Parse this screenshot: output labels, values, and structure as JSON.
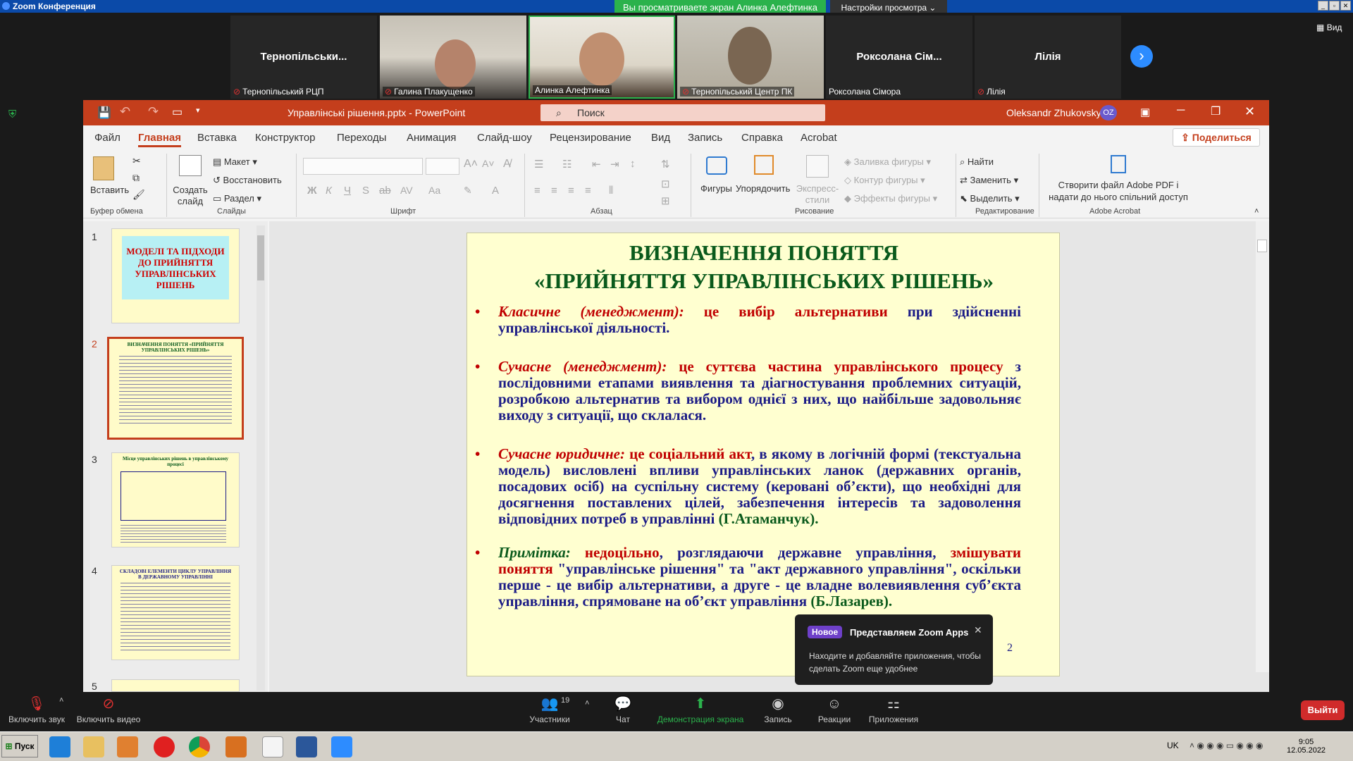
{
  "zoom": {
    "window_title": "Zoom Конференция",
    "share_banner": "Вы просматриваете экран Алинка Алефтинка",
    "view_settings": "Настройки просмотра",
    "view_label": "Вид",
    "participants": [
      {
        "name": "Тернопільськи...",
        "label": "Тернопільський РЦП",
        "muted": true,
        "video": false
      },
      {
        "name": "",
        "label": "Галина Плакущенко",
        "muted": true,
        "video": true
      },
      {
        "name": "",
        "label": "Алинка Алефтинка",
        "muted": false,
        "video": true,
        "active": true
      },
      {
        "name": "",
        "label": "Тернопільський Центр ПК",
        "muted": true,
        "video": true
      },
      {
        "name": "Роксолана Сім...",
        "label": "Роксолана Сімора",
        "muted": false,
        "video": false
      },
      {
        "name": "Лілія",
        "label": "Лілія",
        "muted": true,
        "video": false
      }
    ],
    "toolbar": {
      "audio": "Включить звук",
      "video": "Включить видео",
      "participants": "Участники",
      "participants_count": "19",
      "chat": "Чат",
      "share": "Демонстрация экрана",
      "record": "Запись",
      "reactions": "Реакции",
      "apps": "Приложения",
      "leave": "Выйти"
    },
    "toast": {
      "badge": "Новое",
      "title": "Представляем Zoom Apps",
      "body": "Находите и добавляйте приложения, чтобы сделать Zoom еще удобнее"
    }
  },
  "ppt": {
    "title": "Управлінські рішення.pptx  -  PowerPoint",
    "search_placeholder": "Поиск",
    "user": "Oleksandr Zhukovsky",
    "user_initials": "OZ",
    "share_button": "Поделиться",
    "tabs": [
      "Файл",
      "Главная",
      "Вставка",
      "Конструктор",
      "Переходы",
      "Анимация",
      "Слайд-шоу",
      "Рецензирование",
      "Вид",
      "Запись",
      "Справка",
      "Acrobat"
    ],
    "active_tab": "Главная",
    "ribbon": {
      "clipboard_paste": "Вставить",
      "clipboard_group": "Буфер обмена",
      "new_slide": "Создать слайд",
      "layout": "Макет",
      "reset": "Восстановить",
      "section": "Раздел",
      "slides_group": "Слайды",
      "font_group": "Шрифт",
      "paragraph_group": "Абзац",
      "shapes": "Фигуры",
      "arrange": "Упорядочить",
      "quick_styles": "Экспресс-стили",
      "shape_fill": "Заливка фигуры",
      "shape_outline": "Контур фигуры",
      "shape_effects": "Эффекты фигуры",
      "drawing_group": "Рисование",
      "find": "Найти",
      "replace": "Заменить",
      "select": "Выделить",
      "editing_group": "Редактирование",
      "acrobat_btn": "Створити файл Adobe PDF і надати до нього спільний доступ",
      "acrobat_group": "Adobe Acrobat"
    },
    "thumbnails": [
      {
        "num": "1",
        "text": "МОДЕЛІ ТА ПІДХОДИ ДО ПРИЙНЯТТЯ УПРАВЛІНСЬКИХ РІШЕНЬ"
      },
      {
        "num": "2",
        "text": "ВИЗНАЧЕННЯ ПОНЯТТЯ «ПРИЙНЯТТЯ УПРАВЛІНСЬКИХ РІШЕНЬ»"
      },
      {
        "num": "3",
        "text": "Місце управлінських рішень в управлінському процесі"
      },
      {
        "num": "4",
        "text": "СКЛАДОВІ ЕЛЕМЕНТИ ЦИКЛУ УПРАВЛІННЯ В ДЕРЖАВНОМУ УПРАВЛІННІ"
      },
      {
        "num": "5",
        "text": ""
      }
    ],
    "slide": {
      "title_line1": "ВИЗНАЧЕННЯ ПОНЯТТЯ",
      "title_line2": "«ПРИЙНЯТТЯ УПРАВЛІНСЬКИХ РІШЕНЬ»",
      "b1_term": "Класичне (менеджмент):",
      "b1_red": " це вибір альтернативи",
      "b1_rest": " при здійсненні управлінської діяльності.",
      "b2_term": "Сучасне (менеджмент):",
      "b2_red": " це суттєва частина управлінського процесу",
      "b2_rest": " з послідовними етапами виявлення та діагностування проблемних ситуацій, розробкою альтернатив та вибором однієї з них, що найбільше задовольняє виходу з ситуації, що склалася.",
      "b3_term": "Сучасне юридичне:",
      "b3_red": " це соціальний акт",
      "b3_rest": ", в якому в логічній формі (текстуальна модель) висловлені впливи управлінських ланок (державних органів, посадових осіб) на суспільну систему (керовані об’єкти), що необхідні для досягнення поставлених цілей, забезпечення інтересів та задоволення відповідних потреб в управлінні ",
      "b3_author": "(Г.Атаманчук).",
      "b4_term": "Примітка:",
      "b4_red1": " недоцільно",
      "b4_mid": ", розглядаючи державне управління, ",
      "b4_red2": "змішувати поняття",
      "b4_rest": " \"управлінське рішення\" та \"акт державного управління\", оскільки перше - це вибір альтернативи, а друге - це владне волевиявлення суб’єкта управління, спрямоване на об’єкт управління ",
      "b4_author": "(Б.Лазарев).",
      "page_num": "2"
    }
  },
  "taskbar": {
    "start": "Пуск",
    "lang": "UK",
    "time": "9:05",
    "date": "12.05.2022"
  }
}
